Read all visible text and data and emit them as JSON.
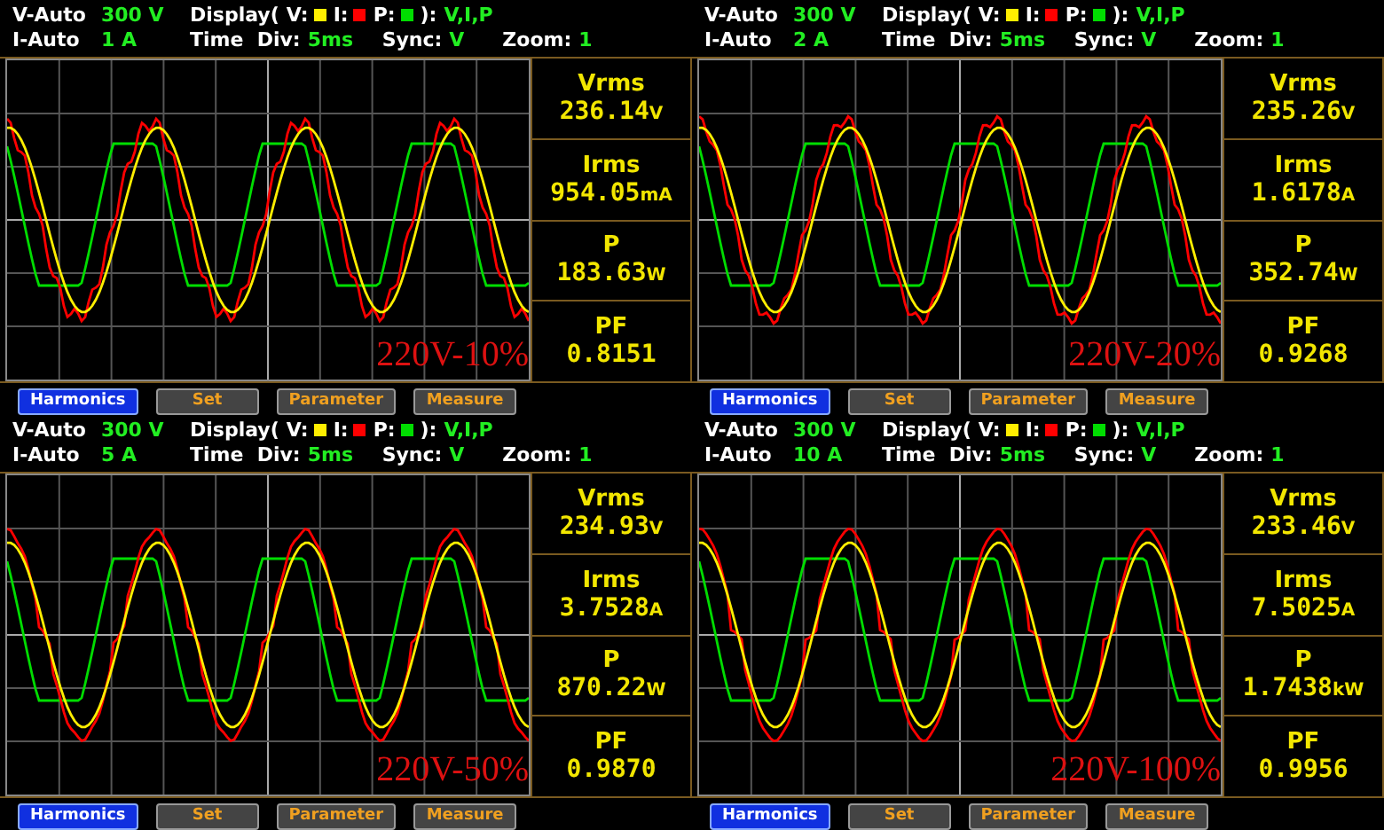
{
  "panels": [
    {
      "v_mode": "V-Auto",
      "v_range": "300 V",
      "i_mode": "I-Auto",
      "i_range": "1 A",
      "display_label": "Display(",
      "legend": [
        {
          "label": "V:",
          "color": "#ffee00"
        },
        {
          "label": "I:",
          "color": "#ff0000"
        },
        {
          "label": "P:",
          "color": "#00dd00"
        }
      ],
      "display_close": "):",
      "display_value": "V,I,P",
      "time_label": "Time  Div:",
      "time_value": "5ms",
      "sync_label": "Sync:",
      "sync_value": "V",
      "zoom_label": "Zoom:",
      "zoom_value": "1",
      "scope_label": "220V-10%",
      "readings": [
        {
          "name": "Vrms",
          "value": "236.14",
          "unit": "V"
        },
        {
          "name": "Irms",
          "value": "954.05",
          "unit": "mA"
        },
        {
          "name": "P",
          "value": "183.63",
          "unit": "W"
        },
        {
          "name": "PF",
          "value": "0.8151"
        }
      ],
      "buttons": [
        {
          "label": "Harmonics",
          "selected": true
        },
        {
          "label": "Set",
          "selected": false
        },
        {
          "label": "Parameter",
          "selected": false
        },
        {
          "label": "Measure",
          "selected": false
        }
      ]
    },
    {
      "v_mode": "V-Auto",
      "v_range": "300 V",
      "i_mode": "I-Auto",
      "i_range": "2 A",
      "display_label": "Display(",
      "legend": [
        {
          "label": "V:",
          "color": "#ffee00"
        },
        {
          "label": "I:",
          "color": "#ff0000"
        },
        {
          "label": "P:",
          "color": "#00dd00"
        }
      ],
      "display_close": "):",
      "display_value": "V,I,P",
      "time_label": "Time  Div:",
      "time_value": "5ms",
      "sync_label": "Sync:",
      "sync_value": "V",
      "zoom_label": "Zoom:",
      "zoom_value": "1",
      "scope_label": "220V-20%",
      "readings": [
        {
          "name": "Vrms",
          "value": "235.26",
          "unit": "V"
        },
        {
          "name": "Irms",
          "value": "1.6178",
          "unit": "A"
        },
        {
          "name": "P",
          "value": "352.74",
          "unit": "W"
        },
        {
          "name": "PF",
          "value": "0.9268"
        }
      ],
      "buttons": [
        {
          "label": "Harmonics",
          "selected": true
        },
        {
          "label": "Set",
          "selected": false
        },
        {
          "label": "Parameter",
          "selected": false
        },
        {
          "label": "Measure",
          "selected": false
        }
      ]
    },
    {
      "v_mode": "V-Auto",
      "v_range": "300 V",
      "i_mode": "I-Auto",
      "i_range": "5 A",
      "display_label": "Display(",
      "legend": [
        {
          "label": "V:",
          "color": "#ffee00"
        },
        {
          "label": "I:",
          "color": "#ff0000"
        },
        {
          "label": "P:",
          "color": "#00dd00"
        }
      ],
      "display_close": "):",
      "display_value": "V,I,P",
      "time_label": "Time  Div:",
      "time_value": "5ms",
      "sync_label": "Sync:",
      "sync_value": "V",
      "zoom_label": "Zoom:",
      "zoom_value": "1",
      "scope_label": "220V-50%",
      "readings": [
        {
          "name": "Vrms",
          "value": "234.93",
          "unit": "V"
        },
        {
          "name": "Irms",
          "value": "3.7528",
          "unit": "A"
        },
        {
          "name": "P",
          "value": "870.22",
          "unit": "W"
        },
        {
          "name": "PF",
          "value": "0.9870"
        }
      ],
      "buttons": [
        {
          "label": "Harmonics",
          "selected": true
        },
        {
          "label": "Set",
          "selected": false
        },
        {
          "label": "Parameter",
          "selected": false
        },
        {
          "label": "Measure",
          "selected": false
        }
      ]
    },
    {
      "v_mode": "V-Auto",
      "v_range": "300 V",
      "i_mode": "I-Auto",
      "i_range": "10 A",
      "display_label": "Display(",
      "legend": [
        {
          "label": "V:",
          "color": "#ffee00"
        },
        {
          "label": "I:",
          "color": "#ff0000"
        },
        {
          "label": "P:",
          "color": "#00dd00"
        }
      ],
      "display_close": "):",
      "display_value": "V,I,P",
      "time_label": "Time  Div:",
      "time_value": "5ms",
      "sync_label": "Sync:",
      "sync_value": "V",
      "zoom_label": "Zoom:",
      "zoom_value": "1",
      "scope_label": "220V-100%",
      "readings": [
        {
          "name": "Vrms",
          "value": "233.46",
          "unit": "V"
        },
        {
          "name": "Irms",
          "value": "7.5025",
          "unit": "A"
        },
        {
          "name": "P",
          "value": "1.7438",
          "unit": "kW"
        },
        {
          "name": "PF",
          "value": "0.9956"
        }
      ],
      "buttons": [
        {
          "label": "Harmonics",
          "selected": true
        },
        {
          "label": "Set",
          "selected": false
        },
        {
          "label": "Parameter",
          "selected": false
        },
        {
          "label": "Measure",
          "selected": false
        }
      ]
    }
  ]
}
